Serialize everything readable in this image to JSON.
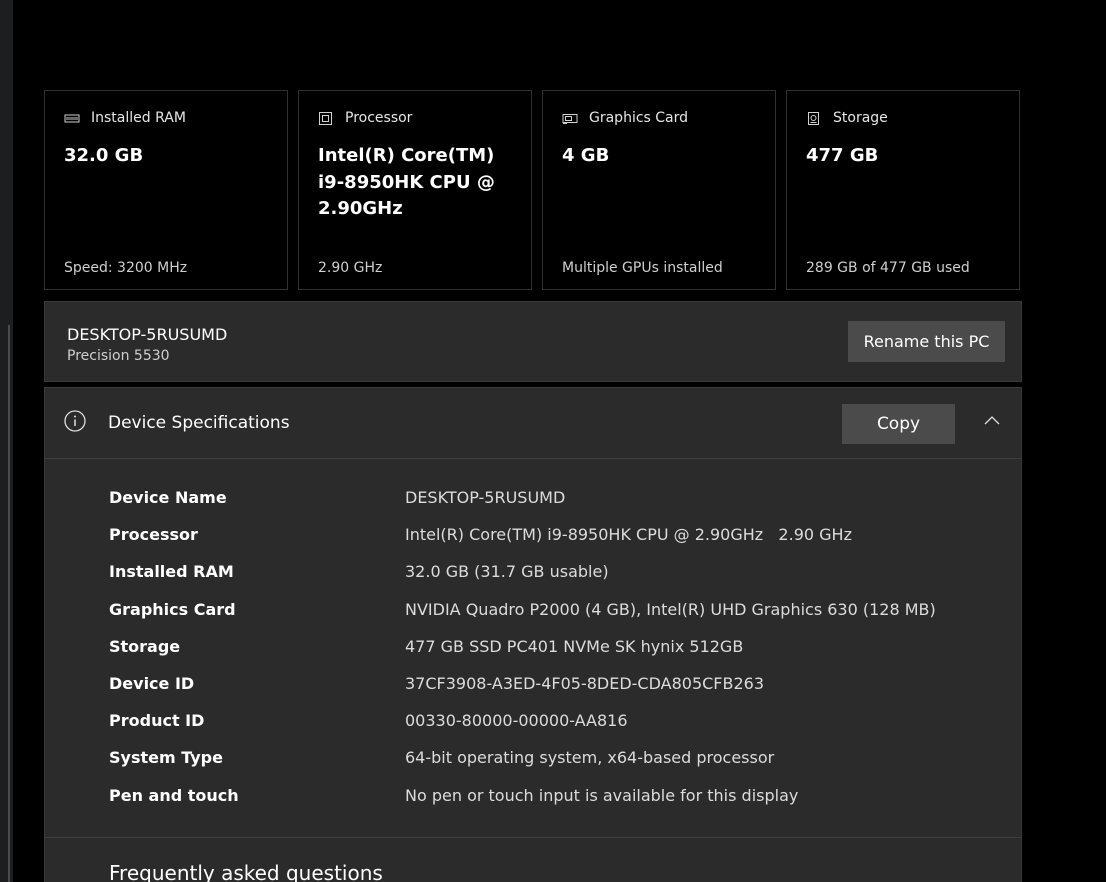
{
  "cards": [
    {
      "icon": "ram-icon",
      "title": "Installed RAM",
      "value": "32.0 GB",
      "footer": "Speed: 3200 MHz"
    },
    {
      "icon": "processor-icon",
      "title": "Processor",
      "value": "Intel(R) Core(TM) i9-8950HK CPU @ 2.90GHz",
      "footer": "2.90 GHz"
    },
    {
      "icon": "graphics-card-icon",
      "title": "Graphics Card",
      "value": "4 GB",
      "footer": "Multiple GPUs installed"
    },
    {
      "icon": "storage-icon",
      "title": "Storage",
      "value": "477 GB",
      "footer": "289 GB of 477 GB used"
    }
  ],
  "pc": {
    "name": "DESKTOP-5RUSUMD",
    "model": "Precision 5530",
    "rename_label": "Rename this PC"
  },
  "specs": {
    "title": "Device Specifications",
    "copy_label": "Copy",
    "rows": [
      {
        "label": "Device Name",
        "value": "DESKTOP-5RUSUMD"
      },
      {
        "label": "Processor",
        "value": "Intel(R) Core(TM) i9-8950HK CPU @ 2.90GHz   2.90 GHz"
      },
      {
        "label": "Installed RAM",
        "value": "32.0 GB (31.7 GB usable)"
      },
      {
        "label": "Graphics Card",
        "value": "NVIDIA Quadro P2000 (4 GB), Intel(R) UHD Graphics 630 (128 MB)"
      },
      {
        "label": "Storage",
        "value": "477 GB SSD PC401 NVMe SK hynix 512GB"
      },
      {
        "label": "Device ID",
        "value": "37CF3908-A3ED-4F05-8DED-CDA805CFB263"
      },
      {
        "label": "Product ID",
        "value": "00330-80000-00000-AA816"
      },
      {
        "label": "System Type",
        "value": "64-bit operating system, x64-based processor"
      },
      {
        "label": "Pen and touch",
        "value": "No pen or touch input is available for this display"
      }
    ]
  },
  "faq": {
    "title": "Frequently asked questions"
  },
  "colors": {
    "background": "#000000",
    "panel": "#2b2b2b",
    "button": "#4b4b4b",
    "border": "#3a3a3a"
  }
}
